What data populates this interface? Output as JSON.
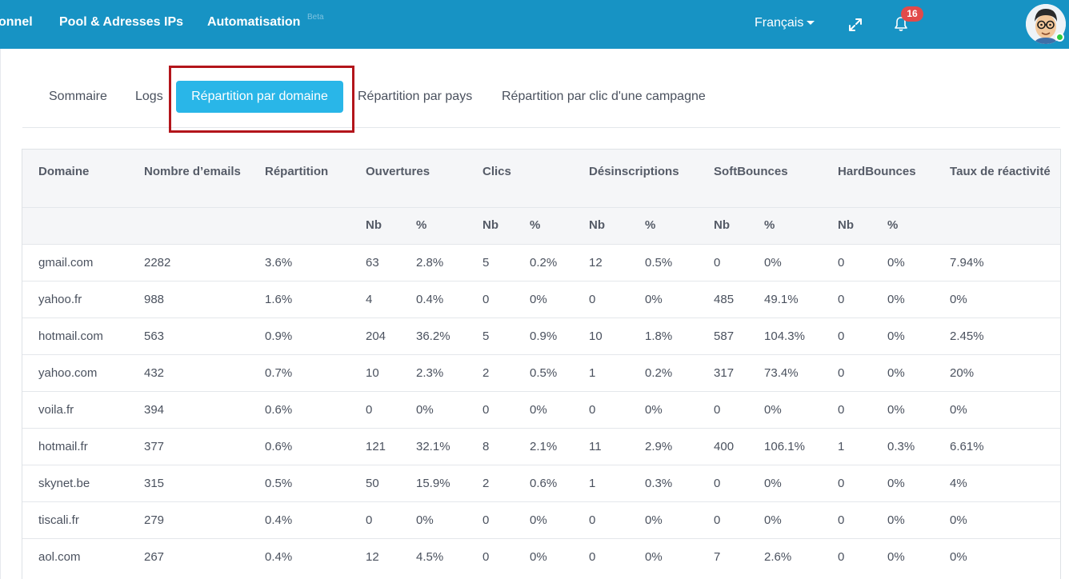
{
  "nav": {
    "items": [
      "onnel",
      "Pool & Adresses IPs",
      "Automatisation"
    ],
    "ghost_text": "Beta",
    "language": "Français",
    "notification_count": "16"
  },
  "tabs": {
    "items": [
      "Sommaire",
      "Logs",
      "Répartition par domaine",
      "Répartition par pays",
      "Répartition par clic d'une campagne"
    ],
    "active_index": 2
  },
  "table": {
    "headers": [
      "Domaine",
      "Nombre d’emails",
      "Répartition",
      "Ouvertures",
      "Clics",
      "Désinscriptions",
      "SoftBounces",
      "HardBounces",
      "Taux de réactivité"
    ],
    "subheaders": {
      "nb": "Nb",
      "pct": "%"
    },
    "rows": [
      [
        "gmail.com",
        "2282",
        "3.6%",
        "63",
        "2.8%",
        "5",
        "0.2%",
        "12",
        "0.5%",
        "0",
        "0%",
        "0",
        "0%",
        "7.94%"
      ],
      [
        "yahoo.fr",
        "988",
        "1.6%",
        "4",
        "0.4%",
        "0",
        "0%",
        "0",
        "0%",
        "485",
        "49.1%",
        "0",
        "0%",
        "0%"
      ],
      [
        "hotmail.com",
        "563",
        "0.9%",
        "204",
        "36.2%",
        "5",
        "0.9%",
        "10",
        "1.8%",
        "587",
        "104.3%",
        "0",
        "0%",
        "2.45%"
      ],
      [
        "yahoo.com",
        "432",
        "0.7%",
        "10",
        "2.3%",
        "2",
        "0.5%",
        "1",
        "0.2%",
        "317",
        "73.4%",
        "0",
        "0%",
        "20%"
      ],
      [
        "voila.fr",
        "394",
        "0.6%",
        "0",
        "0%",
        "0",
        "0%",
        "0",
        "0%",
        "0",
        "0%",
        "0",
        "0%",
        "0%"
      ],
      [
        "hotmail.fr",
        "377",
        "0.6%",
        "121",
        "32.1%",
        "8",
        "2.1%",
        "11",
        "2.9%",
        "400",
        "106.1%",
        "1",
        "0.3%",
        "6.61%"
      ],
      [
        "skynet.be",
        "315",
        "0.5%",
        "50",
        "15.9%",
        "2",
        "0.6%",
        "1",
        "0.3%",
        "0",
        "0%",
        "0",
        "0%",
        "4%"
      ],
      [
        "tiscali.fr",
        "279",
        "0.4%",
        "0",
        "0%",
        "0",
        "0%",
        "0",
        "0%",
        "0",
        "0%",
        "0",
        "0%",
        "0%"
      ],
      [
        "aol.com",
        "267",
        "0.4%",
        "12",
        "4.5%",
        "0",
        "0%",
        "0",
        "0%",
        "7",
        "2.6%",
        "0",
        "0%",
        "0%"
      ]
    ]
  },
  "colors": {
    "topbar": "#1793c4",
    "active_tab": "#29b6e8",
    "highlight_border": "#b3151b",
    "badge": "#e14a4a"
  }
}
